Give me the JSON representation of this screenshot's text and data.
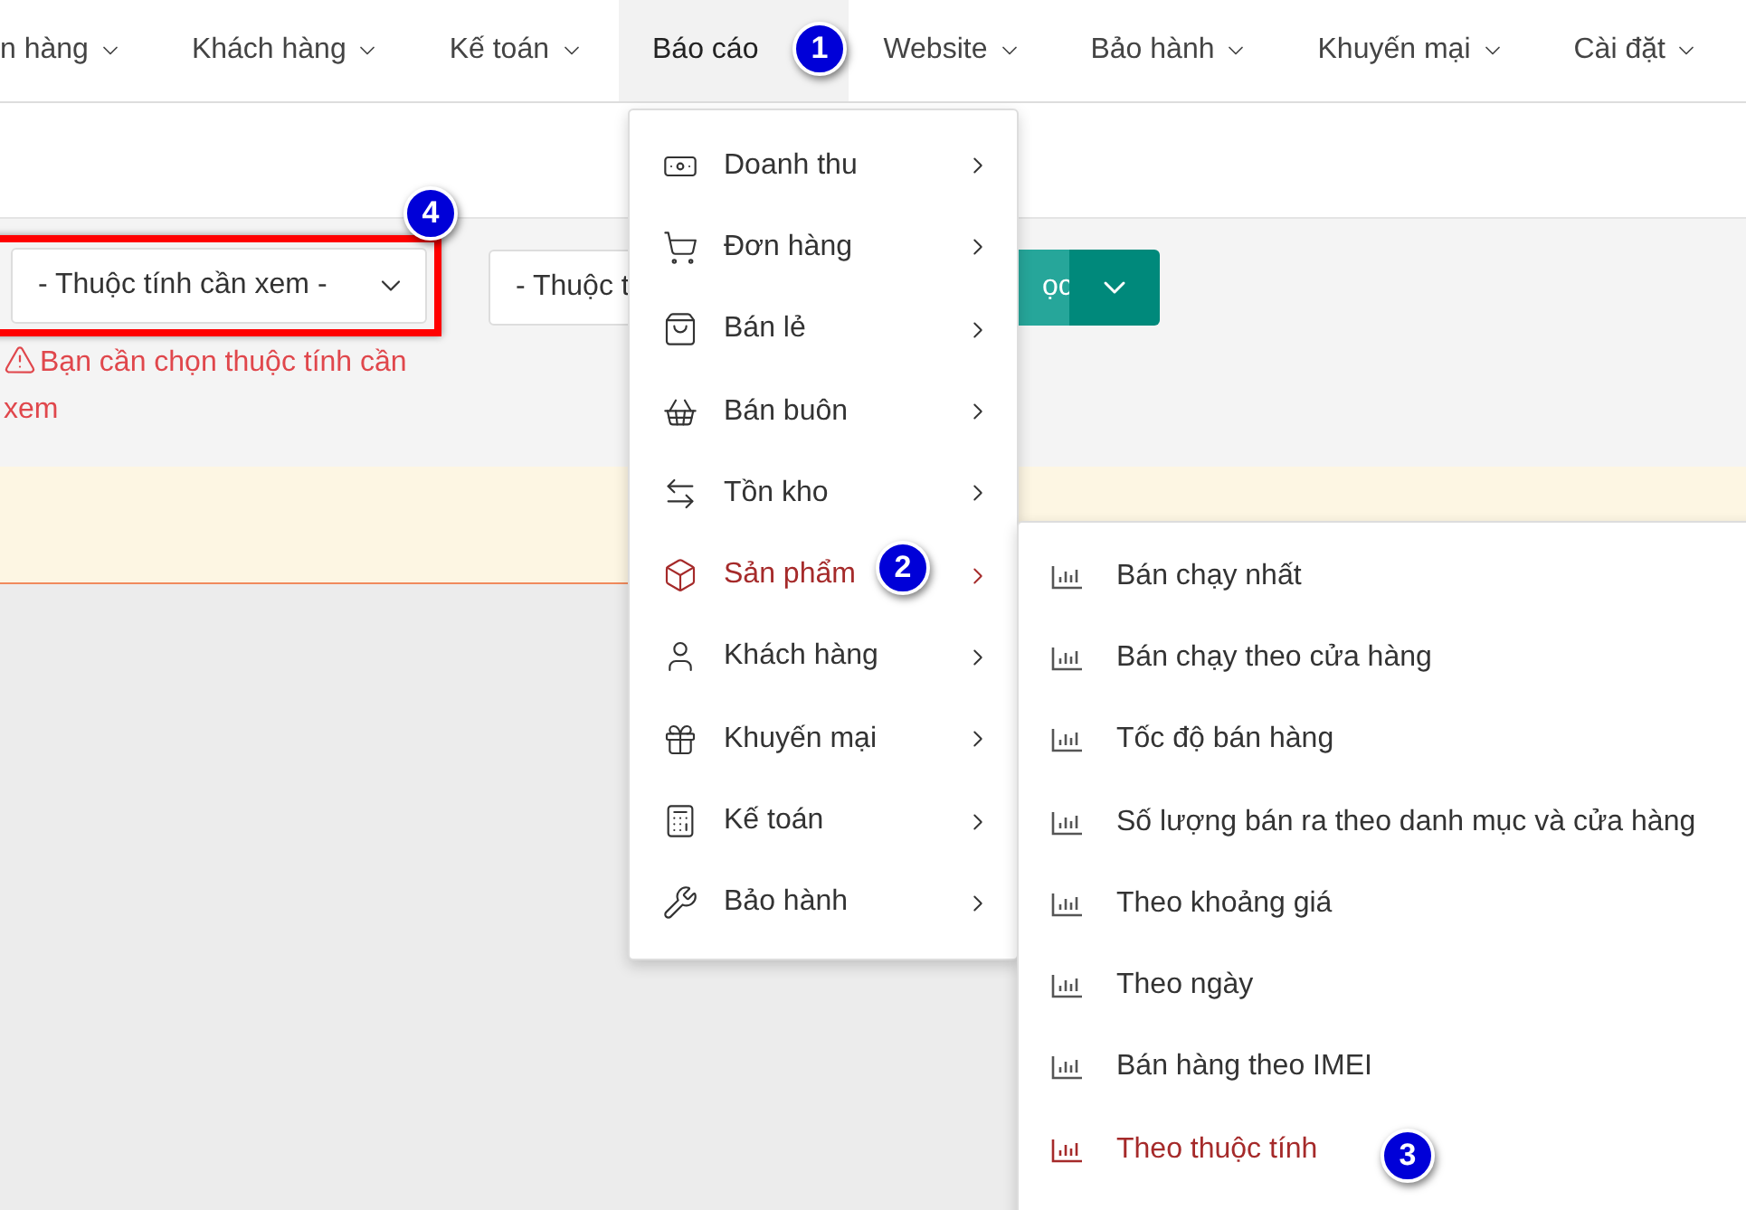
{
  "nav": [
    {
      "label": "n hàng",
      "selected": false
    },
    {
      "label": "Khách hàng",
      "selected": false
    },
    {
      "label": "Kế toán",
      "selected": false
    },
    {
      "label": "Báo cáo",
      "selected": true
    },
    {
      "label": "Website",
      "selected": false
    },
    {
      "label": "Bảo hành",
      "selected": false
    },
    {
      "label": "Khuyến mại",
      "selected": false
    },
    {
      "label": "Cài đặt",
      "selected": false
    }
  ],
  "filters": {
    "attribute_select": {
      "value": "- Thuộc tính cần xem -"
    },
    "error": "Bạn cần chọn thuộc tính cần xem",
    "second_select": {
      "value": "- Thuộc t"
    },
    "action_button": {
      "label": "ọc"
    }
  },
  "report_menu": [
    {
      "label": "Doanh thu",
      "selected": false
    },
    {
      "label": "Đơn hàng",
      "selected": false
    },
    {
      "label": "Bán lẻ",
      "selected": false
    },
    {
      "label": "Bán buôn",
      "selected": false
    },
    {
      "label": "Tồn kho",
      "selected": false
    },
    {
      "label": "Sản phẩm",
      "selected": true
    },
    {
      "label": "Khách hàng",
      "selected": false
    },
    {
      "label": "Khuyến mại",
      "selected": false
    },
    {
      "label": "Kế toán",
      "selected": false
    },
    {
      "label": "Bảo hành",
      "selected": false
    }
  ],
  "product_submenu": [
    {
      "label": "Bán chạy nhất",
      "selected": false
    },
    {
      "label": "Bán chạy theo cửa hàng",
      "selected": false
    },
    {
      "label": "Tốc độ bán hàng",
      "selected": false
    },
    {
      "label": "Số lượng bán ra theo danh mục và cửa hàng",
      "selected": false
    },
    {
      "label": "Theo khoảng giá",
      "selected": false
    },
    {
      "label": "Theo ngày",
      "selected": false
    },
    {
      "label": "Bán hàng theo IMEI",
      "selected": false
    },
    {
      "label": "Theo thuộc tính",
      "selected": true
    }
  ],
  "callouts": [
    "1",
    "2",
    "3",
    "4"
  ]
}
